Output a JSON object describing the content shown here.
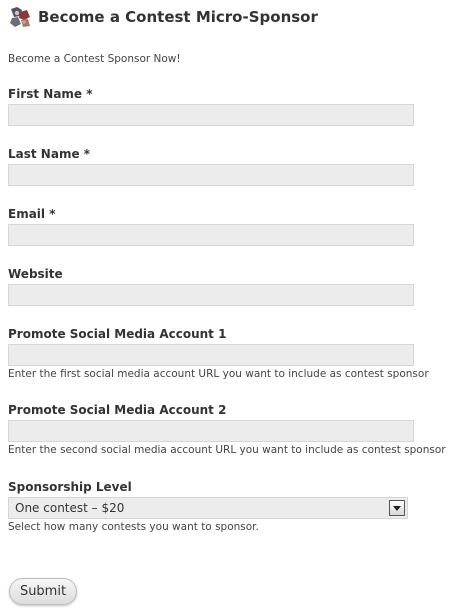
{
  "header": {
    "title": "Become a Contest Micro-Sponsor",
    "icon": "sponsor-avatar-icon"
  },
  "intro": "Become a Contest Sponsor Now!",
  "fields": {
    "first_name": {
      "label": "First Name *",
      "value": ""
    },
    "last_name": {
      "label": "Last Name *",
      "value": ""
    },
    "email": {
      "label": "Email *",
      "value": ""
    },
    "website": {
      "label": "Website",
      "value": ""
    },
    "social_1": {
      "label": "Promote Social Media Account 1",
      "value": "",
      "hint": "Enter the first social media account URL you want to include as contest sponsor"
    },
    "social_2": {
      "label": "Promote Social Media Account 2",
      "value": "",
      "hint": "Enter the second social media account URL you want to include as contest sponsor"
    }
  },
  "sponsorship": {
    "label": "Sponsorship Level",
    "selected": "One contest – $20",
    "hint": "Select how many contests you want to sponsor."
  },
  "submit_label": "Submit",
  "colors": {
    "input_bg": "#ececec",
    "text": "#333333"
  }
}
